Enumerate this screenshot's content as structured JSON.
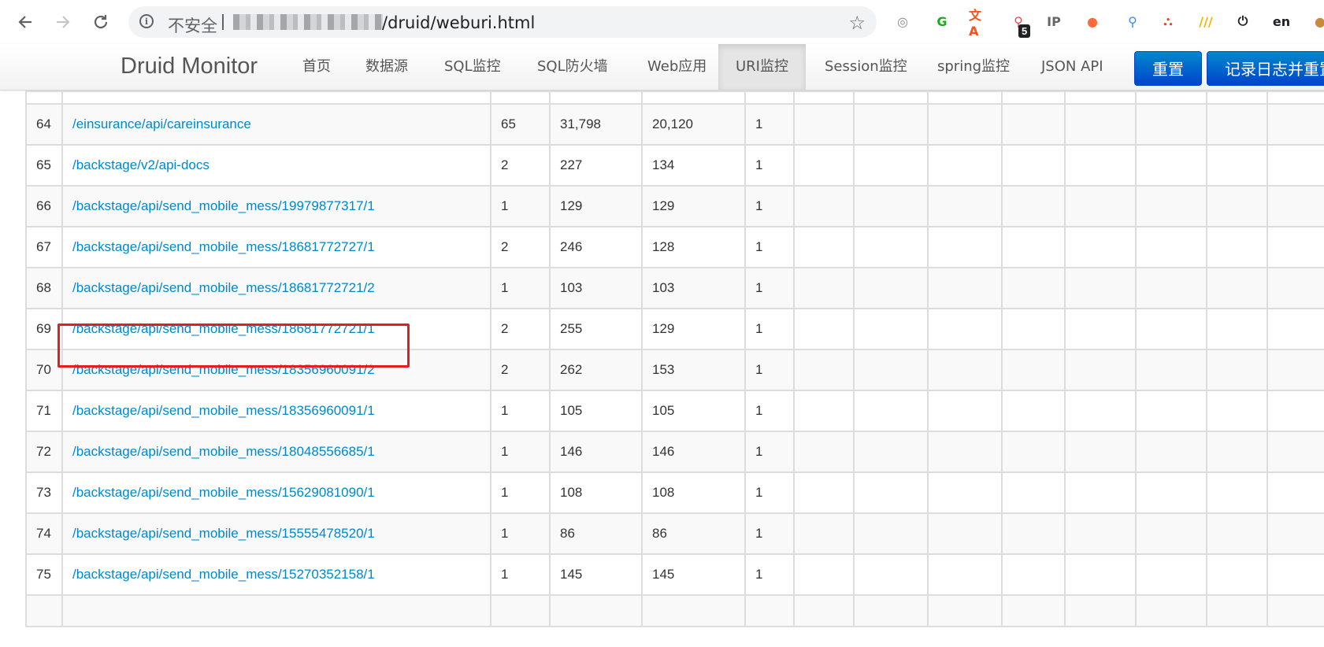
{
  "browser": {
    "security_label": "不安全",
    "url_path": "/druid/weburi.html",
    "extension_badge": "5",
    "extensions": [
      {
        "name": "record-extension-icon",
        "glyph": "◎",
        "color": "#8a8a8a"
      },
      {
        "name": "g-extension-icon",
        "glyph": "G",
        "color": "#1aad19"
      },
      {
        "name": "translate-extension-icon",
        "glyph": "文A",
        "color": "#ff4d1c"
      },
      {
        "name": "link-extension-icon",
        "glyph": "⚲",
        "color": "#d9534f"
      },
      {
        "name": "ip-extension-icon",
        "glyph": "IP",
        "color": "#666666"
      },
      {
        "name": "rss-extension-icon",
        "glyph": "●",
        "color": "#ff6a3d"
      },
      {
        "name": "pin-extension-icon",
        "glyph": "⚲",
        "color": "#3a8de8"
      },
      {
        "name": "network-extension-icon",
        "glyph": "⛬",
        "color": "#e0452f"
      },
      {
        "name": "stripes-extension-icon",
        "glyph": "///",
        "color": "#f5b400"
      },
      {
        "name": "power-extension-icon",
        "glyph": "⏻",
        "color": "#202124"
      },
      {
        "name": "language-extension-icon",
        "glyph": "en",
        "color": "#202124"
      },
      {
        "name": "cookie-extension-icon",
        "glyph": "●",
        "color": "#c88a3b"
      }
    ]
  },
  "navbar": {
    "brand": "Druid Monitor",
    "items": [
      {
        "label": "首页",
        "name": "nav-home"
      },
      {
        "label": "数据源",
        "name": "nav-datasource"
      },
      {
        "label": "SQL监控",
        "name": "nav-sql-monitor"
      },
      {
        "label": "SQL防火墙",
        "name": "nav-sql-firewall"
      },
      {
        "label": "Web应用",
        "name": "nav-web-app"
      },
      {
        "label": "URI监控",
        "name": "nav-uri-monitor",
        "active": true
      },
      {
        "label": "Session监控",
        "name": "nav-session-monitor"
      },
      {
        "label": "spring监控",
        "name": "nav-spring-monitor"
      },
      {
        "label": "JSON API",
        "name": "nav-json-api"
      }
    ],
    "reset_label": "重置",
    "log_reset_label": "记录日志并重置"
  },
  "table": {
    "rows": [
      {
        "n": "64",
        "uri": "/einsurance/api/careinsurance",
        "req": "65",
        "time": "31,798",
        "max": "20,120",
        "conc": "1"
      },
      {
        "n": "65",
        "uri": "/backstage/v2/api-docs",
        "req": "2",
        "time": "227",
        "max": "134",
        "conc": "1"
      },
      {
        "n": "66",
        "uri": "/backstage/api/send_mobile_mess/19979877317/1",
        "req": "1",
        "time": "129",
        "max": "129",
        "conc": "1"
      },
      {
        "n": "67",
        "uri": "/backstage/api/send_mobile_mess/18681772727/1",
        "req": "2",
        "time": "246",
        "max": "128",
        "conc": "1"
      },
      {
        "n": "68",
        "uri": "/backstage/api/send_mobile_mess/18681772721/2",
        "req": "1",
        "time": "103",
        "max": "103",
        "conc": "1"
      },
      {
        "n": "69",
        "uri": "/backstage/api/send_mobile_mess/18681772721/1",
        "req": "2",
        "time": "255",
        "max": "129",
        "conc": "1"
      },
      {
        "n": "70",
        "uri": "/backstage/api/send_mobile_mess/18356960091/2",
        "req": "2",
        "time": "262",
        "max": "153",
        "conc": "1"
      },
      {
        "n": "71",
        "uri": "/backstage/api/send_mobile_mess/18356960091/1",
        "req": "1",
        "time": "105",
        "max": "105",
        "conc": "1"
      },
      {
        "n": "72",
        "uri": "/backstage/api/send_mobile_mess/18048556685/1",
        "req": "1",
        "time": "146",
        "max": "146",
        "conc": "1"
      },
      {
        "n": "73",
        "uri": "/backstage/api/send_mobile_mess/15629081090/1",
        "req": "1",
        "time": "108",
        "max": "108",
        "conc": "1"
      },
      {
        "n": "74",
        "uri": "/backstage/api/send_mobile_mess/15555478520/1",
        "req": "1",
        "time": "86",
        "max": "86",
        "conc": "1"
      },
      {
        "n": "75",
        "uri": "/backstage/api/send_mobile_mess/15270352158/1",
        "req": "1",
        "time": "145",
        "max": "145",
        "conc": "1"
      }
    ]
  }
}
